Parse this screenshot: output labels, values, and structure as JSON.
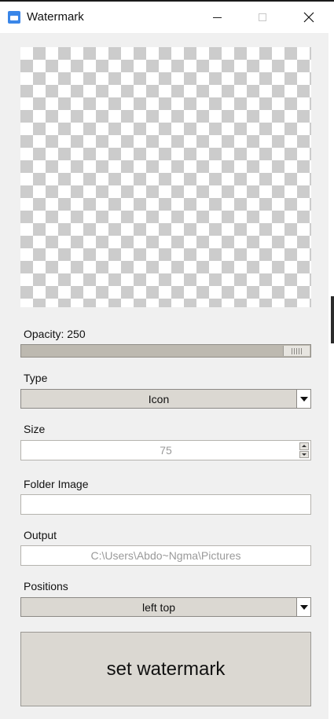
{
  "window": {
    "title": "Watermark",
    "controls": {
      "minimize": "minimize",
      "maximize": "maximize",
      "close": "close"
    }
  },
  "opacity": {
    "label": "Opacity: 250",
    "value": 250
  },
  "type": {
    "label": "Type",
    "selected": "Icon"
  },
  "size": {
    "label": "Size",
    "value": "75"
  },
  "folder_image": {
    "label": "Folder Image",
    "value": ""
  },
  "output": {
    "label": "Output",
    "value": "C:\\Users\\Abdo~Ngma\\Pictures"
  },
  "positions": {
    "label": "Positions",
    "selected": "left top"
  },
  "action": {
    "button_label": "set watermark"
  },
  "colors": {
    "client_bg": "#f0f0f0",
    "control_bg": "#dbd8d2",
    "accent": "#3a86e8"
  }
}
